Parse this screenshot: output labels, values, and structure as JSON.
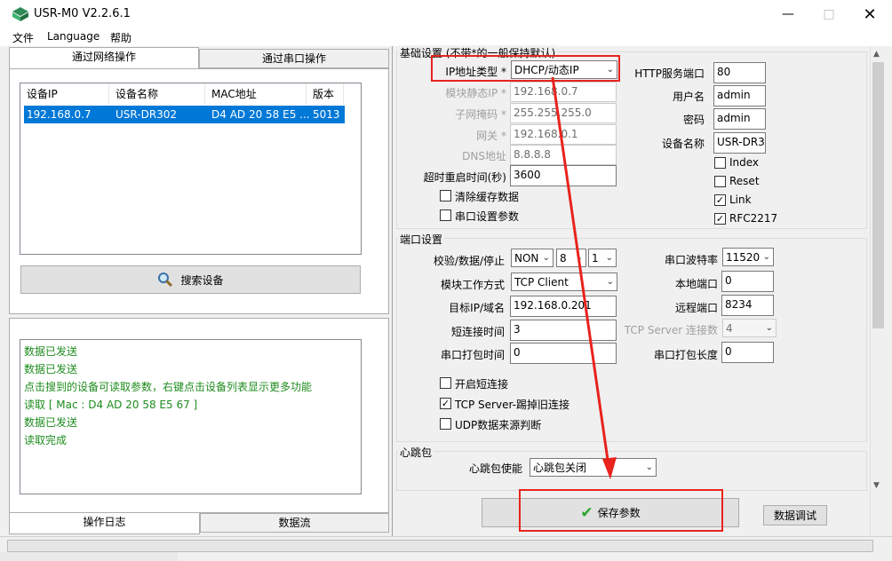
{
  "window": {
    "title": "USR-M0 V2.2.6.1"
  },
  "menu": [
    "文件",
    "Language",
    "帮助"
  ],
  "left": {
    "tabs": [
      "通过网络操作",
      "通过串口操作"
    ],
    "device_list": {
      "columns": [
        "设备IP",
        "设备名称",
        "MAC地址",
        "版本"
      ],
      "rows": [
        {
          "ip": "192.168.0.7",
          "name": "USR-DR302",
          "mac": "D4 AD 20 58 E5 ...",
          "version": "5013"
        }
      ]
    },
    "search_button": "搜索设备",
    "log": [
      "数据已发送",
      "数据已发送",
      "点击搜到的设备可读取参数，右键点击设备列表显示更多功能",
      "读取 [ Mac : D4 AD 20 58 E5 67 ]",
      "数据已发送",
      "读取完成"
    ],
    "bottom_tabs": [
      "操作日志",
      "数据流"
    ]
  },
  "basic": {
    "group_title": "基础设置 (不带*的一般保持默认)",
    "ip_type_label": "IP地址类型 *",
    "ip_type_value": "DHCP/动态IP",
    "static_ip_label": "模块静态IP *",
    "static_ip": "192.168.0.7",
    "mask_label": "子网掩码 *",
    "mask": "255.255.255.0",
    "gateway_label": "网关 *",
    "gateway": "192.168.0.1",
    "dns_label": "DNS地址",
    "dns": "8.8.8.8",
    "timeout_label": "超时重启时间(秒)",
    "timeout": "3600",
    "clear_cache": "清除缓存数据",
    "serial_params": "串口设置参数",
    "http_port_label": "HTTP服务端口",
    "http_port": "80",
    "username_label": "用户名",
    "username": "admin",
    "password_label": "密码",
    "password": "admin",
    "device_name_label": "设备名称",
    "device_name": "USR-DR3",
    "index": "Index",
    "reset": "Reset",
    "link": "Link",
    "rfc2217": "RFC2217"
  },
  "port": {
    "group_title": "端口设置",
    "parity_label": "校验/数据/停止",
    "parity": "NON",
    "data_bits": "8",
    "stop_bits": "1",
    "mode_label": "模块工作方式",
    "mode": "TCP Client",
    "target_label": "目标IP/域名",
    "target": "192.168.0.201",
    "short_conn_label": "短连接时间",
    "short_conn": "3",
    "pack_time_label": "串口打包时间",
    "pack_time": "0",
    "enable_short": "开启短连接",
    "kick_old": "TCP Server-踢掉旧连接",
    "udp_source": "UDP数据来源判断",
    "baud_label": "串口波特率",
    "baud": "11520",
    "local_port_label": "本地端口",
    "local_port": "0",
    "remote_port_label": "远程端口",
    "remote_port": "8234",
    "tcp_conn_label": "TCP Server 连接数",
    "tcp_conn": "4",
    "pack_len_label": "串口打包长度",
    "pack_len": "0"
  },
  "heartbeat": {
    "group_title": "心跳包",
    "enable_label": "心跳包使能",
    "enable_value": "心跳包关闭"
  },
  "buttons": {
    "save": "保存参数",
    "debug": "数据调试"
  },
  "colors": {
    "selection": "#0078d7",
    "log_text": "#1e8c1e",
    "annotation": "#e8231d"
  }
}
